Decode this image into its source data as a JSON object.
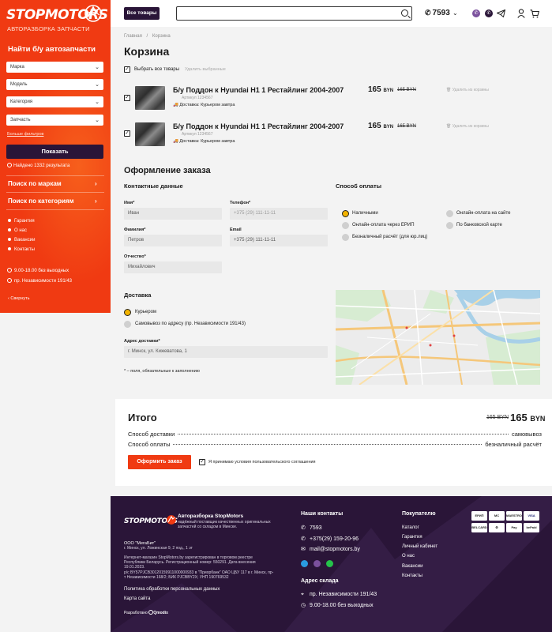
{
  "colors": {
    "brand": "#f03a12",
    "dark": "#2a1538",
    "accent_yellow": "#f2b300"
  },
  "sidebar": {
    "logo": "STOPMOTORS",
    "logo_sub": "АВТОРАЗБОРКА  ЗАПЧАСТИ",
    "title": "Найти б/у автозапчасти",
    "selects": [
      "Марка",
      "Модель",
      "Категория",
      "Запчасть"
    ],
    "more_filters": "Больше фильтров",
    "show_button": "Показать",
    "found": "Найдено 1332 результата",
    "links": [
      "Поиск по маркам",
      "Поиск по категориям"
    ],
    "menu": [
      "Гарантия",
      "О нас",
      "Вакансии",
      "Контакты"
    ],
    "hours": "9.00-18.00 без выходных",
    "address": "пр. Независимости 191/43",
    "collapse": "Свернуть"
  },
  "topbar": {
    "all_goods": "Все товары",
    "phone": "7593",
    "icons": [
      "viber-icon",
      "whatsapp-icon",
      "telegram-icon",
      "user-icon",
      "cart-icon"
    ]
  },
  "breadcrumb": {
    "home": "Главная",
    "sep": "/",
    "current": "Корзина"
  },
  "page_title": "Корзина",
  "cart": {
    "select_all": "Выбрать все товары",
    "delete_selected": "Удалить выбранные",
    "items": [
      {
        "title": "Б/у Поддон к Hyundai H1 1 Рестайлинг 2004-2007",
        "article": "Артикул 1234567",
        "delivery": "Доставка: Курьером завтра",
        "price": "165",
        "currency": "BYN",
        "old_price": "165 BYN",
        "remove": "Удалить из корзины"
      },
      {
        "title": "Б/у Поддон к Hyundai H1 1 Рестайлинг 2004-2007",
        "article": "Артикул 1234567",
        "delivery": "Доставка: Курьером завтра",
        "price": "165",
        "currency": "BYN",
        "old_price": "165 BYN",
        "remove": "Удалить из корзины"
      }
    ]
  },
  "checkout": {
    "title": "Оформление заказа",
    "contacts_title": "Контактные данные",
    "fields": {
      "first_name": {
        "label": "Имя*",
        "value": "Иван"
      },
      "phone": {
        "label": "Телефон*",
        "placeholder": "+375 (29) 111-11-11"
      },
      "last_name": {
        "label": "Фамилия*",
        "value": "Петров"
      },
      "email": {
        "label": "Email",
        "value": "+375 (29) 111-11-11"
      },
      "patronymic": {
        "label": "Отчество*",
        "value": "Михайлович"
      }
    },
    "payment_title": "Способ оплаты",
    "payment_options": [
      "Наличными",
      "Онлайн-оплата на сайте",
      "Онлайн-оплата через ЕРИП",
      "По банковской карте",
      "Безналичный расчёт (для юр.лиц)"
    ],
    "delivery_title": "Доставка",
    "delivery_options": [
      "Курьером",
      "Самовывоз по адресу (пр. Независимости 191/43)"
    ],
    "address_label": "Адрес доставки*",
    "address_value": "г. Минск, ул. Кижеватова, 1",
    "required_note": "* – поля, обязательные к заполнению"
  },
  "total": {
    "title": "Итого",
    "old": "165 BYN",
    "price": "165",
    "currency": "BYN",
    "rows": [
      {
        "label": "Способ доставки",
        "value": "самовывоз"
      },
      {
        "label": "Способ оплаты",
        "value": "безналичный расчёт"
      }
    ],
    "order_button": "Оформить заказ",
    "agree": "Я принимаю условия пользовательского соглашения"
  },
  "footer": {
    "logo": "STOPMOTORS",
    "tag_title": "Авторазборка StopMotors",
    "tag": "надёжный поставщик качественных оригинальных запчастей со складом в Минске.",
    "company": "ООО \"МегаБит\"",
    "company_addr": "г. Минск, ул. Ложинская 9, 2 под., 1 эт",
    "legal": "Интернет-магазин StopMotors.by зарегистрирован в торговом реестре Республики Беларусь. Регистрационный номер: 550291. Дата внесения 19.01.2023.",
    "bank": "р/с BY57PJCB30120159911000000933 в \"Приорбанк\" ОАО ЦБУ 117 в г. Минск, пр-т Независимости 168/2; БИК PJCBBY2X; УНП 190769532",
    "policy": "Политика обработки персональных данных",
    "sitemap": "Карта сайта",
    "dev": "Разработано",
    "dev_brand": "Qmodix",
    "contacts_title": "Наши контакты",
    "phone1": "7593",
    "phone2": "+375(29) 159-20-96",
    "email": "mail@stopmotors.by",
    "warehouse_title": "Адрес склада",
    "warehouse_addr": "пр. Независимости 191/43",
    "warehouse_hours": "9.00-18.00 без выходных",
    "buyer_title": "Покупателю",
    "buyer_links": [
      "Каталог",
      "Гарантия",
      "Личный кабинет",
      "О нас",
      "Вакансии",
      "Контакты"
    ],
    "payments": [
      "ЕРИП",
      "MC",
      "MAESTRO",
      "VISA",
      "BELCARD",
      "⚙",
      "Pay",
      "bePaid"
    ]
  }
}
